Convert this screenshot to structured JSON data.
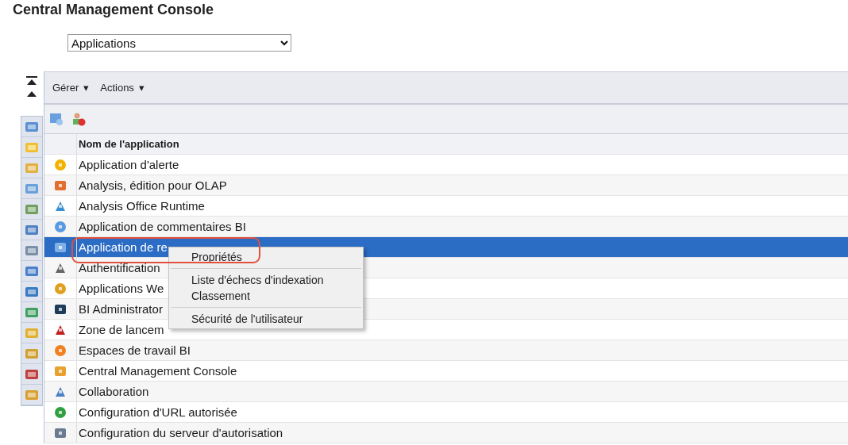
{
  "title": "Central Management Console",
  "view_select": {
    "value": "Applications"
  },
  "toolbar": {
    "menus": [
      {
        "label": "Gérer",
        "caret": "▾"
      },
      {
        "label": "Actions",
        "caret": "▾"
      }
    ]
  },
  "table": {
    "columns": [
      "Nom de l'application"
    ],
    "rows": [
      {
        "name": "Application d'alerte",
        "selected": false
      },
      {
        "name": "Analysis, édition pour OLAP",
        "selected": false
      },
      {
        "name": "Analysis Office Runtime",
        "selected": false
      },
      {
        "name": "Application de commentaires BI",
        "selected": false
      },
      {
        "name": "Application de re",
        "selected": true
      },
      {
        "name": "Authentification",
        "selected": false
      },
      {
        "name": "Applications We",
        "selected": false
      },
      {
        "name": "BI Administrator",
        "selected": false
      },
      {
        "name": "Zone de lancem",
        "selected": false
      },
      {
        "name": "Espaces de travail BI",
        "selected": false
      },
      {
        "name": "Central Management Console",
        "selected": false
      },
      {
        "name": "Collaboration",
        "selected": false
      },
      {
        "name": "Configuration d'URL autorisée",
        "selected": false
      },
      {
        "name": "Configuration du serveur d'autorisation",
        "selected": false
      }
    ]
  },
  "context_menu": {
    "groups": [
      [
        "Propriétés"
      ],
      [
        "Liste d'échecs d'indexation",
        "Classement"
      ],
      [
        "Sécurité de l'utilisateur"
      ]
    ]
  }
}
